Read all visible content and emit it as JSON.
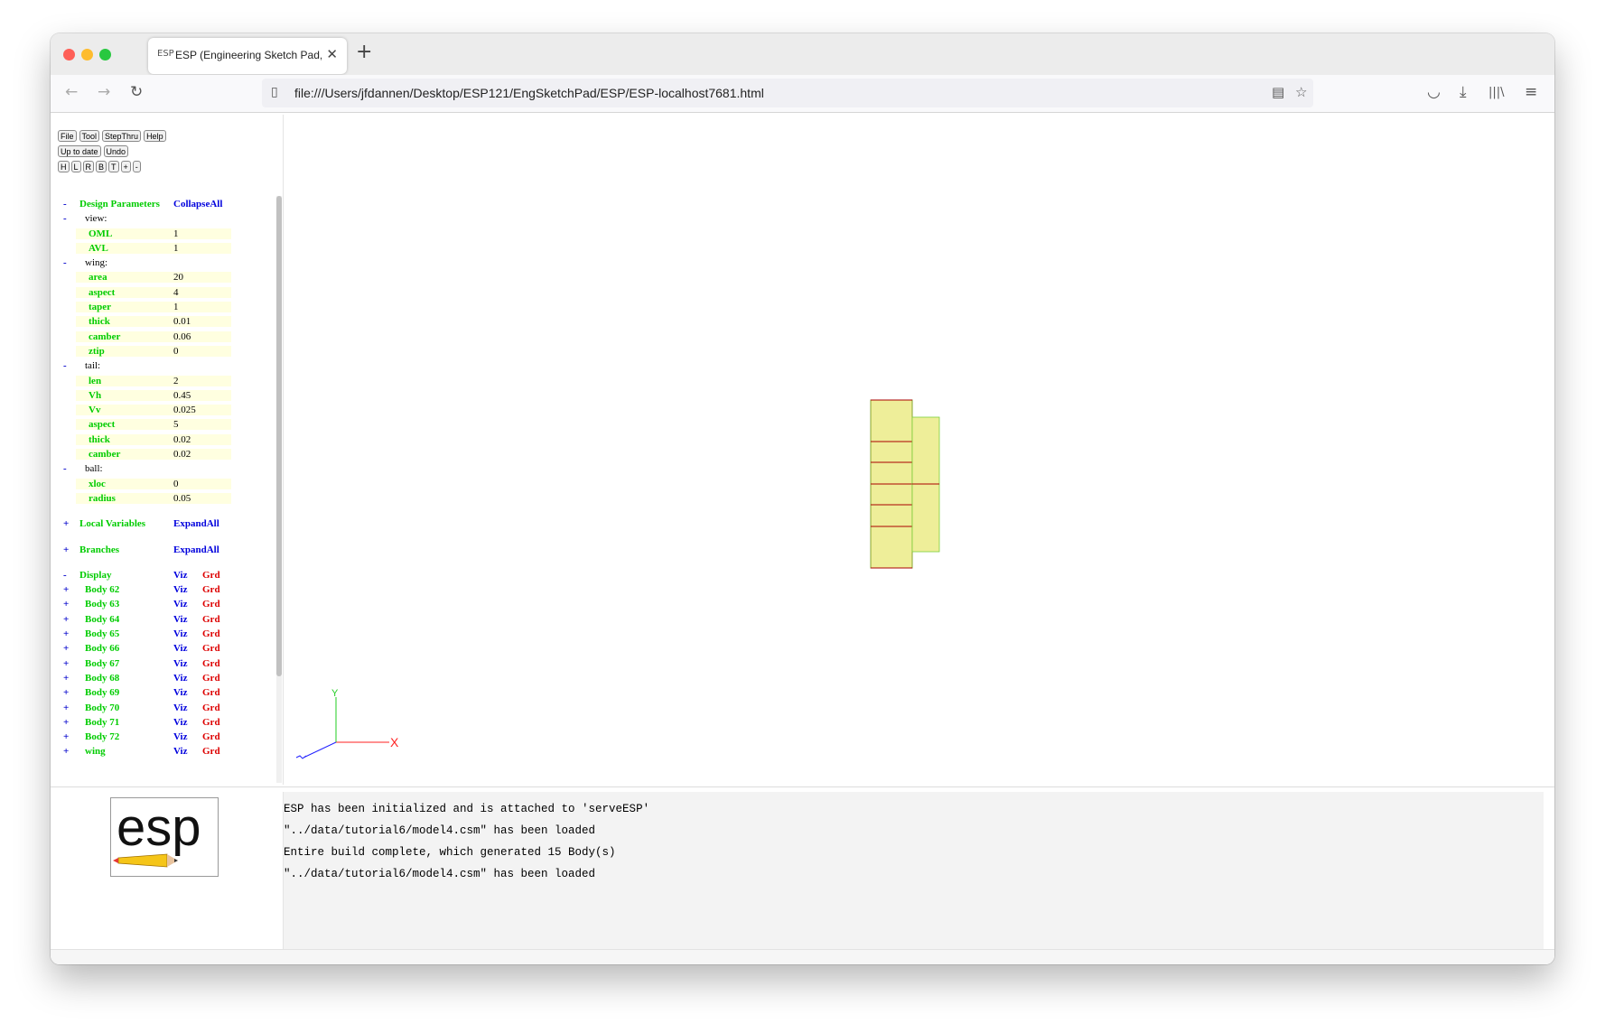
{
  "browser": {
    "tab_title": "ESP (Engineering Sketch Pad, V",
    "tab_favicon": "ESP",
    "url": "file:///Users/jfdannen/Desktop/ESP121/EngSketchPad/ESP/ESP-localhost7681.html",
    "icons": {
      "back": "←",
      "forward": "→",
      "reload": "↻",
      "page": "▯",
      "reader": "▤",
      "bookmark": "☆",
      "pocket": "◡",
      "download": "⤓",
      "library": "|||\\",
      "menu": "≡",
      "close": "✕",
      "newtab": "+"
    }
  },
  "toolbar": {
    "row1": [
      "File",
      "Tool",
      "StepThru",
      "Help"
    ],
    "row2": [
      "Up to date",
      "Undo"
    ],
    "row3": [
      "H",
      "L",
      "R",
      "B",
      "T",
      "+",
      "-"
    ]
  },
  "tree": {
    "design_header": {
      "pm": "-",
      "label": "Design Parameters",
      "action": "CollapseAll"
    },
    "groups": [
      {
        "pm": "-",
        "label": "view:",
        "params": [
          {
            "name": "OML",
            "value": "1"
          },
          {
            "name": "AVL",
            "value": "1"
          }
        ]
      },
      {
        "pm": "-",
        "label": "wing:",
        "params": [
          {
            "name": "area",
            "value": "20"
          },
          {
            "name": "aspect",
            "value": "4"
          },
          {
            "name": "taper",
            "value": "1"
          },
          {
            "name": "thick",
            "value": "0.01"
          },
          {
            "name": "camber",
            "value": "0.06"
          },
          {
            "name": "ztip",
            "value": "0"
          }
        ]
      },
      {
        "pm": "-",
        "label": "tail:",
        "params": [
          {
            "name": "len",
            "value": "2"
          },
          {
            "name": "Vh",
            "value": "0.45"
          },
          {
            "name": "Vv",
            "value": "0.025"
          },
          {
            "name": "aspect",
            "value": "5"
          },
          {
            "name": "thick",
            "value": "0.02"
          },
          {
            "name": "camber",
            "value": "0.02"
          }
        ]
      },
      {
        "pm": "-",
        "label": "ball:",
        "params": [
          {
            "name": "xloc",
            "value": "0"
          },
          {
            "name": "radius",
            "value": "0.05"
          }
        ]
      }
    ],
    "local_vars": {
      "pm": "+",
      "label": "Local Variables",
      "action": "ExpandAll"
    },
    "branches": {
      "pm": "+",
      "label": "Branches",
      "action": "ExpandAll"
    },
    "display": {
      "pm": "-",
      "label": "Display",
      "viz": "Viz",
      "grd": "Grd"
    },
    "bodies": [
      {
        "pm": "+",
        "name": "Body 62",
        "viz": "Viz",
        "grd": "Grd"
      },
      {
        "pm": "+",
        "name": "Body 63",
        "viz": "Viz",
        "grd": "Grd"
      },
      {
        "pm": "+",
        "name": "Body 64",
        "viz": "Viz",
        "grd": "Grd"
      },
      {
        "pm": "+",
        "name": "Body 65",
        "viz": "Viz",
        "grd": "Grd"
      },
      {
        "pm": "+",
        "name": "Body 66",
        "viz": "Viz",
        "grd": "Grd"
      },
      {
        "pm": "+",
        "name": "Body 67",
        "viz": "Viz",
        "grd": "Grd"
      },
      {
        "pm": "+",
        "name": "Body 68",
        "viz": "Viz",
        "grd": "Grd"
      },
      {
        "pm": "+",
        "name": "Body 69",
        "viz": "Viz",
        "grd": "Grd"
      },
      {
        "pm": "+",
        "name": "Body 70",
        "viz": "Viz",
        "grd": "Grd"
      },
      {
        "pm": "+",
        "name": "Body 71",
        "viz": "Viz",
        "grd": "Grd"
      },
      {
        "pm": "+",
        "name": "Body 72",
        "viz": "Viz",
        "grd": "Grd"
      },
      {
        "pm": "+",
        "name": "wing",
        "viz": "Viz",
        "grd": "Grd"
      }
    ]
  },
  "axes": {
    "x": "X",
    "y": "Y"
  },
  "logo": "esp",
  "messages": [
    "ESP has been initialized and is attached to 'serveESP'",
    "\"../data/tutorial6/model4.csm\" has been loaded",
    "Entire build complete, which generated 15 Body(s)",
    "\"../data/tutorial6/model4.csm\" has been loaded"
  ],
  "colors": {
    "param_green": "#00cc00",
    "link_blue": "#0000dd",
    "grd_red": "#dd0000",
    "wing_fill": "#eeee99",
    "wing_edge": "#aa0000"
  }
}
